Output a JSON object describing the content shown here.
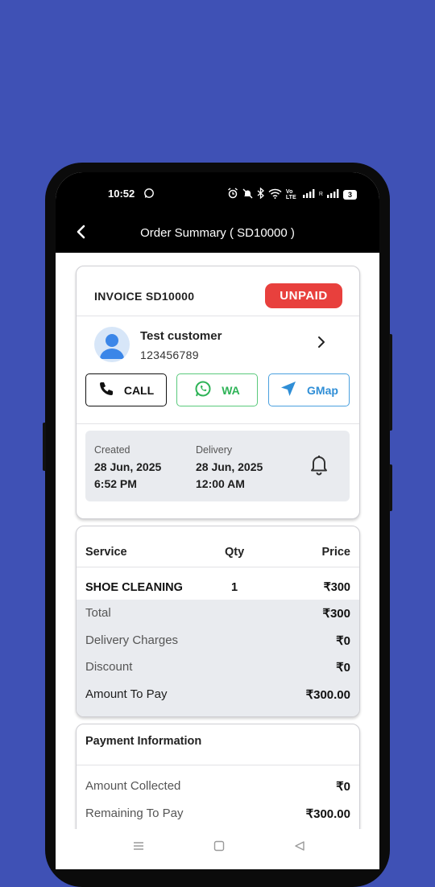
{
  "status_bar": {
    "time": "10:52",
    "network_label": "Vo LTE",
    "roaming_label": "R",
    "battery": "3"
  },
  "app_bar": {
    "title": "Order Summary ( SD10000 )",
    "back_icon": "back-arrow-icon"
  },
  "invoice": {
    "title": "INVOICE SD10000",
    "status": "UNPAID",
    "status_color": "#e8403d"
  },
  "customer": {
    "name": "Test customer",
    "phone": "123456789"
  },
  "actions": {
    "call_label": "CALL",
    "wa_label": "WA",
    "gmap_label": "GMap",
    "wa_color": "#2eb357",
    "gmap_color": "#2f8ed6"
  },
  "dates": {
    "created_label": "Created",
    "created_date": "28 Jun, 2025",
    "created_time": "6:52 PM",
    "delivery_label": "Delivery",
    "delivery_date": "28 Jun, 2025",
    "delivery_time": "12:00 AM"
  },
  "service_table": {
    "headers": {
      "service": "Service",
      "qty": "Qty",
      "price": "Price"
    },
    "rows": [
      {
        "service": "SHOE CLEANING",
        "qty": "1",
        "price": "₹300"
      }
    ]
  },
  "summary": [
    {
      "label": "Total",
      "value": "₹300"
    },
    {
      "label": "Delivery Charges",
      "value": "₹0"
    },
    {
      "label": "Discount",
      "value": "₹0"
    },
    {
      "label": "Amount To Pay",
      "value": "₹300.00"
    }
  ],
  "payment": {
    "title": "Payment Information",
    "rows": [
      {
        "label": "Amount Collected",
        "value": "₹0"
      },
      {
        "label": "Remaining To Pay",
        "value": "₹300.00"
      }
    ]
  },
  "colors": {
    "background": "#3f51b5",
    "accent_red": "#e8403d",
    "panel_gray": "#e9ebef"
  }
}
